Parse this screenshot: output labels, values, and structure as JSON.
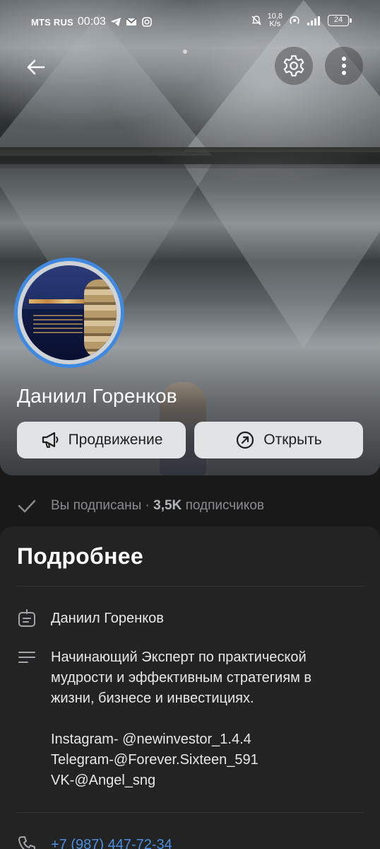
{
  "status_bar": {
    "carrier": "MTS RUS",
    "time": "00:03",
    "speed_value": "10,8",
    "speed_unit": "K/s",
    "battery": "24"
  },
  "header": {
    "back_icon": "arrow-left-icon",
    "settings_icon": "gear-icon",
    "more_icon": "vertical-dots-icon"
  },
  "profile": {
    "name": "Даниил Горенков",
    "accent_color": "#3f8ae0",
    "buttons": [
      {
        "label": "Продвижение",
        "icon": "megaphone-icon"
      },
      {
        "label": "Открыть",
        "icon": "arrow-up-right-circle-icon"
      }
    ]
  },
  "subscription": {
    "status": "Вы подписаны ·",
    "count": "3,5K",
    "count_label": "подписчиков"
  },
  "details": {
    "title": "Подробнее",
    "name_row": "Даниил Горенков",
    "description_lines": [
      "Начинающий Эксперт по практической",
      "мудрости и эффективным стратегиям в",
      "жизни, бизнесе и инвестициях."
    ],
    "social_lines": [
      "Instagram- @newinvestor_1.4.4",
      "Telegram-@Forever.Sixteen_591",
      "VK-@Angel_sng"
    ],
    "phone": "+7 (987) 447-72-34",
    "link_color": "#4a8fe0"
  }
}
